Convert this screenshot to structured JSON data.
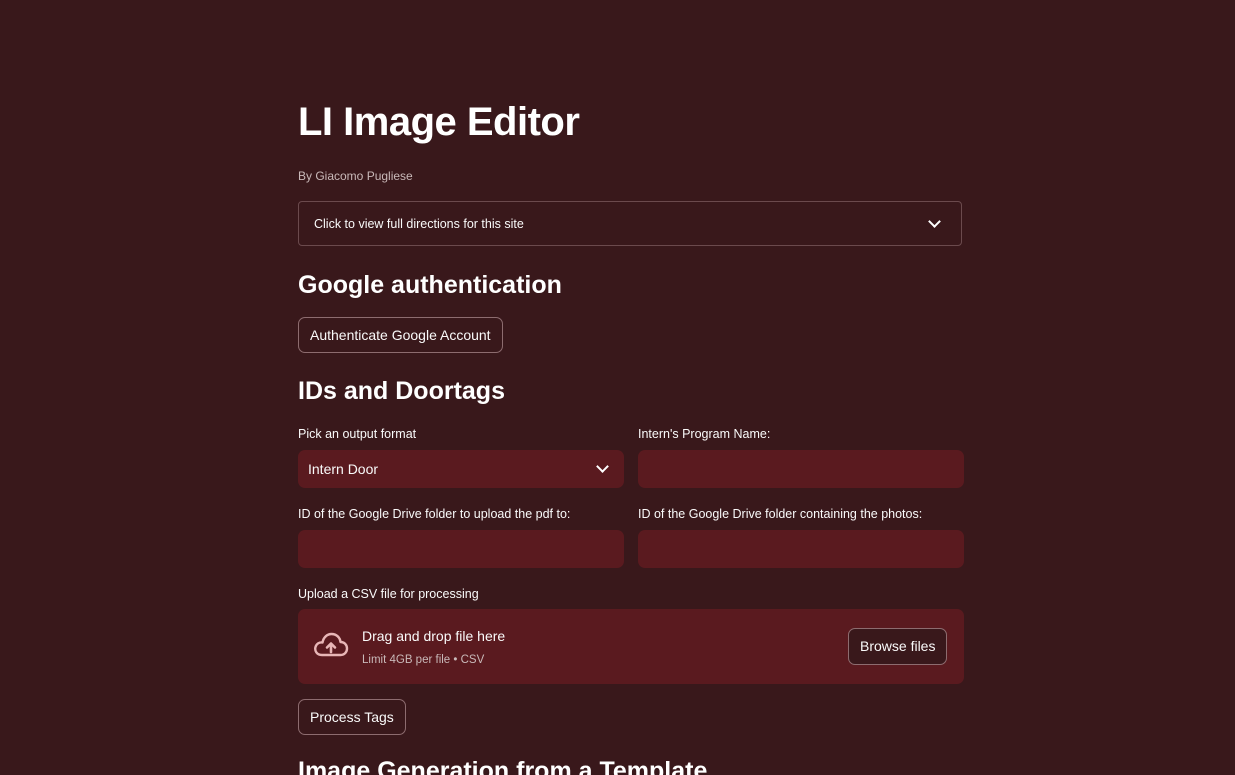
{
  "app": {
    "title": "LI Image Editor",
    "byline": "By Giacomo Pugliese"
  },
  "directions_expander": {
    "label": "Click to view full directions for this site",
    "icon": "chevron-down-icon",
    "expanded": false
  },
  "google_auth": {
    "heading": "Google authentication",
    "button_label": "Authenticate Google Account"
  },
  "ids_doortags": {
    "heading": "IDs and Doortags",
    "output_format": {
      "label": "Pick an output format",
      "selected": "Intern Door"
    },
    "program_name": {
      "label": "Intern's Program Name:",
      "value": ""
    },
    "upload_folder": {
      "label": "ID of the Google Drive folder to upload the pdf to:",
      "value": ""
    },
    "photos_folder": {
      "label": "ID of the Google Drive folder containing the photos:",
      "value": ""
    },
    "csv_upload": {
      "label": "Upload a CSV file for processing",
      "dropzone_title": "Drag and drop file here",
      "dropzone_limit": "Limit 4GB per file • CSV",
      "browse_label": "Browse files",
      "icon": "cloud-upload-icon"
    },
    "process_button_label": "Process Tags"
  },
  "image_generation": {
    "heading": "Image Generation from a Template"
  },
  "colors": {
    "background": "#39181b",
    "input_background": "#5a1a1f",
    "border": "#8d6c6f",
    "text": "#fafafa"
  }
}
